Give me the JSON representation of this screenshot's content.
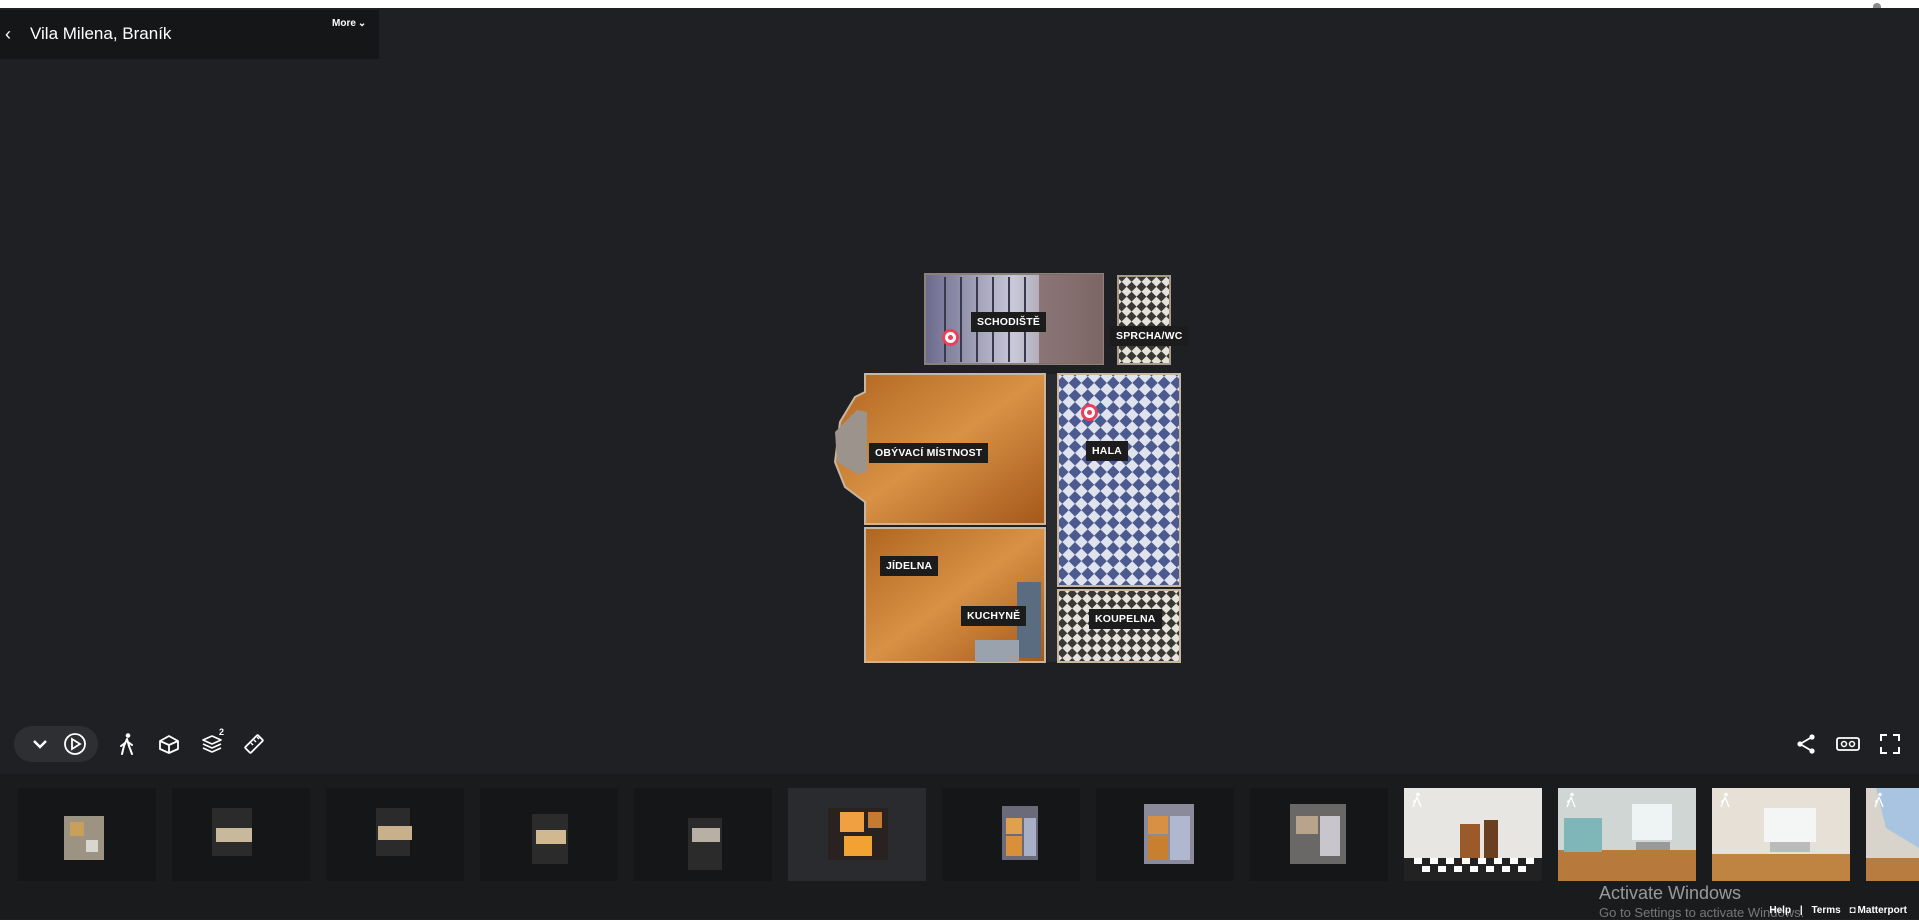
{
  "header": {
    "title": "Vila Milena, Braník",
    "more_label": "More"
  },
  "rooms": [
    {
      "label": "SCHODIŠTĚ"
    },
    {
      "label": "SPRCHA/WC"
    },
    {
      "label": "OBÝVACÍ MÍSTNOST"
    },
    {
      "label": "HALA"
    },
    {
      "label": "JÍDELNA"
    },
    {
      "label": "KUCHYNĚ"
    },
    {
      "label": "KOUPELNA"
    }
  ],
  "toolbar": {
    "left_icons": [
      "chevron-down-icon",
      "play-icon",
      "walk-icon",
      "dollhouse-icon",
      "floors-icon",
      "measure-icon"
    ],
    "floors_badge": "2",
    "right_icons": [
      "share-icon",
      "vr-icon",
      "fullscreen-icon"
    ]
  },
  "thumbnails": [
    {
      "kind": "dollhouse"
    },
    {
      "kind": "dollhouse"
    },
    {
      "kind": "dollhouse"
    },
    {
      "kind": "dollhouse"
    },
    {
      "kind": "dollhouse"
    },
    {
      "kind": "floorplan"
    },
    {
      "kind": "floorplan"
    },
    {
      "kind": "floorplan"
    },
    {
      "kind": "floorplan"
    },
    {
      "kind": "photo"
    },
    {
      "kind": "photo"
    },
    {
      "kind": "photo"
    },
    {
      "kind": "photo"
    }
  ],
  "system_watermark": {
    "line1": "Activate Windows",
    "line2": "Go to Settings to activate Windows."
  },
  "footer": {
    "help": "Help",
    "sep": "|",
    "terms": "Terms",
    "brand": "Matterport"
  },
  "colors": {
    "background": "#1f2023",
    "panel": "#151618",
    "marker": "#e8415b"
  }
}
